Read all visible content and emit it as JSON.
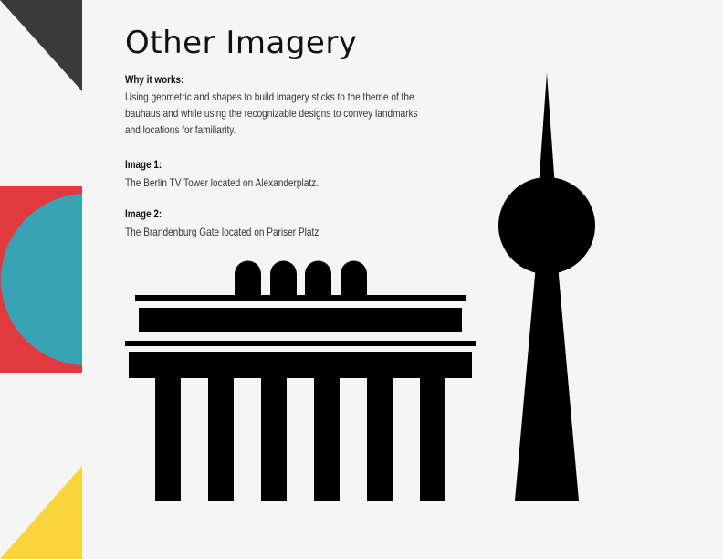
{
  "slide": {
    "title": "Other Imagery",
    "why_label": "Why it works:",
    "why_text": "Using geometric and shapes to build imagery sticks to the theme of the bauhaus and while using the recognizable designs to convey landmarks and locations for familiarity.",
    "image1_label": "Image 1:",
    "image1_text": "The Berlin TV Tower located on Alexanderplatz.",
    "image2_label": "Image 2:",
    "image2_text": "The Brandenburg Gate located on Pariser Platz"
  },
  "colors": {
    "background": "#f5f5f5",
    "dark_triangle": "#3a3a3a",
    "red_block": "#e0393e",
    "teal_circle": "#38a3b4",
    "yellow_triangle": "#f9d43c",
    "silhouette": "#000000"
  }
}
